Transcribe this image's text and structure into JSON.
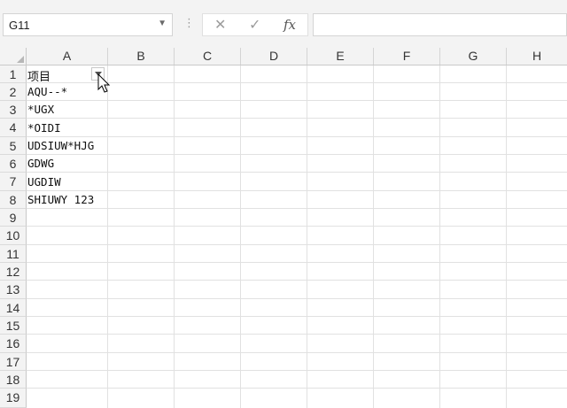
{
  "name_box": {
    "value": "G11"
  },
  "formula_bar": {
    "cancel": "✕",
    "enter": "✓",
    "insert_function": "fx",
    "value": ""
  },
  "columns": [
    "A",
    "B",
    "C",
    "D",
    "E",
    "F",
    "G",
    "H"
  ],
  "rows": [
    "1",
    "2",
    "3",
    "4",
    "5",
    "6",
    "7",
    "8",
    "9",
    "10",
    "11",
    "12",
    "13",
    "14",
    "15",
    "16",
    "17",
    "18",
    "19"
  ],
  "cells": {
    "A1": "项目",
    "A2": "AQU--*",
    "A3": "*UGX",
    "A4": "*OIDI",
    "A5": "UDSIUW*HJG",
    "A6": "GDWG",
    "A7": "UGDIW",
    "A8": "SHIUWY 123"
  },
  "icons": [
    "dropdown-arrow-icon",
    "vertical-dots-icon",
    "cancel-icon",
    "enter-icon",
    "insert-function-icon",
    "select-all-triangle-icon",
    "filter-dropdown-icon",
    "mouse-pointer-icon"
  ]
}
